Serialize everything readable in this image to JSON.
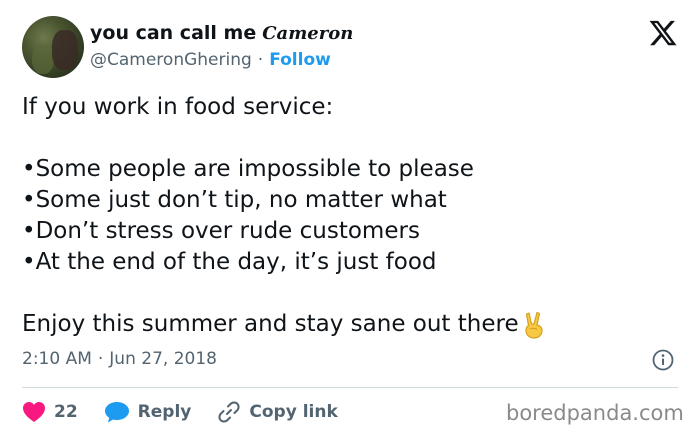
{
  "author": {
    "display_name": "you can call me",
    "display_name_script": "Cameron",
    "handle": "@CameronGhering",
    "separator": "·",
    "follow_label": "Follow"
  },
  "tweet": {
    "intro": "If you work in food service:",
    "bullets": [
      "•Some people are impossible to please",
      "•Some just don’t tip, no matter what",
      "•Don’t stress over rude customers",
      "•At the end of the day, it’s just food"
    ],
    "closing": "Enjoy this summer and stay sane out there",
    "emoji": "victory-hand-icon"
  },
  "meta": {
    "time": "2:10 AM",
    "separator": "·",
    "date": "Jun 27, 2018"
  },
  "actions": {
    "like_count": "22",
    "reply_label": "Reply",
    "copy_link_label": "Copy link"
  },
  "watermark": "boredpanda.com",
  "colors": {
    "link_blue": "#1d9bf0",
    "like_red": "#f91880",
    "muted": "#536471"
  }
}
